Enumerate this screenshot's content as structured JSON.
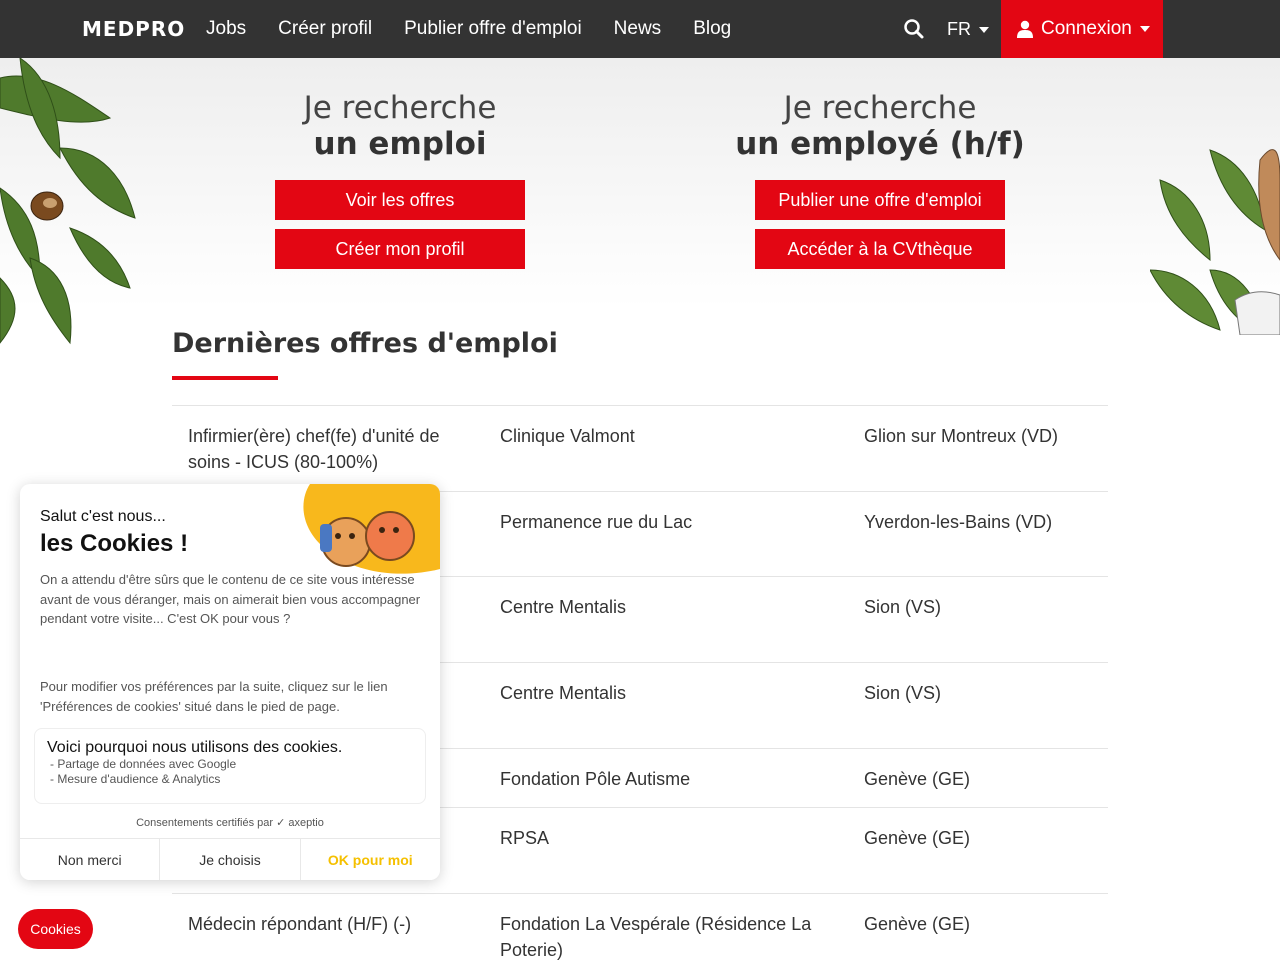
{
  "nav": {
    "brand": "MEDPRO",
    "links": [
      "Jobs",
      "Créer profil",
      "Publier offre d'emploi",
      "News",
      "Blog"
    ],
    "language": "FR",
    "login_label": "Connexion"
  },
  "hero": {
    "candidate": {
      "lead": "Je recherche",
      "strong": "un emploi",
      "btn1": "Voir les offres",
      "btn2": "Créer mon profil"
    },
    "employer": {
      "lead": "Je recherche",
      "strong": "un employé (h/f)",
      "btn1": "Publier une offre d'emploi",
      "btn2": "Accéder à la CVthèque"
    }
  },
  "jobs": {
    "title": "Dernières offres d'emploi",
    "rows": [
      {
        "title": "Infirmier(ère) chef(fe) d'unité de soins - ICUS (80-100%)",
        "employer": "Clinique Valmont",
        "location": "Glion sur Montreux (VD)"
      },
      {
        "title": "",
        "employer": "Permanence rue du Lac",
        "location": "Yverdon-les-Bains (VD)"
      },
      {
        "title": "",
        "employer": "Centre Mentalis",
        "location": "Sion (VS)"
      },
      {
        "title": "",
        "employer": "Centre Mentalis",
        "location": "Sion (VS)"
      },
      {
        "title": "",
        "employer": "Fondation Pôle Autisme",
        "location": "Genève (GE)"
      },
      {
        "title": "",
        "employer": "RPSA",
        "location": "Genève (GE)"
      },
      {
        "title": "Médecin répondant (H/F) (-)",
        "employer": "Fondation La Vespérale (Résidence La Poterie)",
        "location": "Genève (GE)"
      }
    ]
  },
  "cookie": {
    "hello": "Salut c'est nous...",
    "title": "les Cookies !",
    "body": "On a attendu d'être sûrs que le contenu de ce site vous intéresse avant de vous déranger, mais on aimerait bien vous accompagner pendant votre visite... C'est OK pour vous ?",
    "body2": "Pour modifier vos préférences par la suite, cliquez sur le lien 'Préférences de cookies' situé dans le pied de page.",
    "why_title": "Voici pourquoi nous utilisons des cookies.",
    "reasons": [
      "- Partage de données avec Google",
      "- Mesure d'audience & Analytics"
    ],
    "certified": "Consentements certifiés par ✓ axeptio",
    "buttons": {
      "refuse": "Non merci",
      "choose": "Je choisis",
      "accept": "OK pour moi"
    }
  },
  "cookies_pill": "Cookies",
  "colors": {
    "nav_bg": "#333333",
    "brand_red": "#e30613",
    "cookie_accent": "#f5c000"
  },
  "icons": [
    "search-icon",
    "user-icon",
    "caret-down-icon"
  ]
}
